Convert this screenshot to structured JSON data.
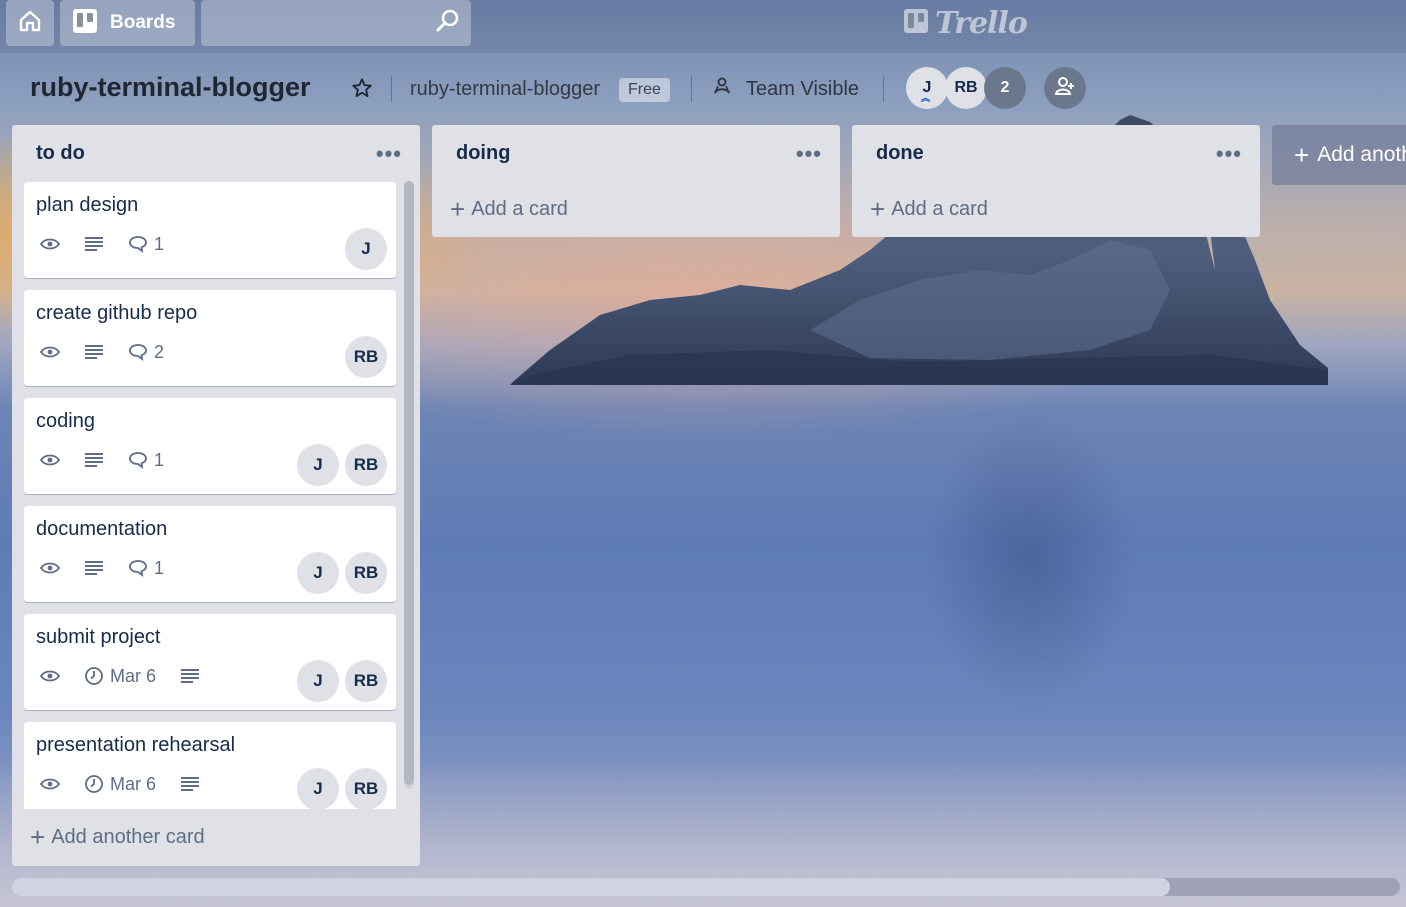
{
  "header": {
    "boards_label": "Boards",
    "logo_text": "Trello"
  },
  "board": {
    "title": "ruby-terminal-blogger",
    "org_name": "ruby-terminal-blogger",
    "plan_badge": "Free",
    "visibility": "Team Visible",
    "members": [
      "J",
      "RB"
    ],
    "member_overflow": "2"
  },
  "lists": [
    {
      "title": "to do",
      "add_label": "Add another card",
      "cards": [
        {
          "title": "plan design",
          "comments": "1",
          "members": [
            "J"
          ]
        },
        {
          "title": "create github repo",
          "comments": "2",
          "members": [
            "RB"
          ]
        },
        {
          "title": "coding",
          "comments": "1",
          "members": [
            "J",
            "RB"
          ]
        },
        {
          "title": "documentation",
          "comments": "1",
          "members": [
            "J",
            "RB"
          ]
        },
        {
          "title": "submit project",
          "due": "Mar 6",
          "members": [
            "J",
            "RB"
          ]
        },
        {
          "title": "presentation rehearsal",
          "due": "Mar 6",
          "members": [
            "J",
            "RB"
          ]
        }
      ]
    },
    {
      "title": "doing",
      "add_label": "Add a card"
    },
    {
      "title": "done",
      "add_label": "Add a card"
    }
  ],
  "add_list_label": "Add another list",
  "colors": {
    "list_bg": "#dfe1e6",
    "card_bg": "#ffffff",
    "text_primary": "#172b4d",
    "text_muted": "#5e6c84"
  }
}
